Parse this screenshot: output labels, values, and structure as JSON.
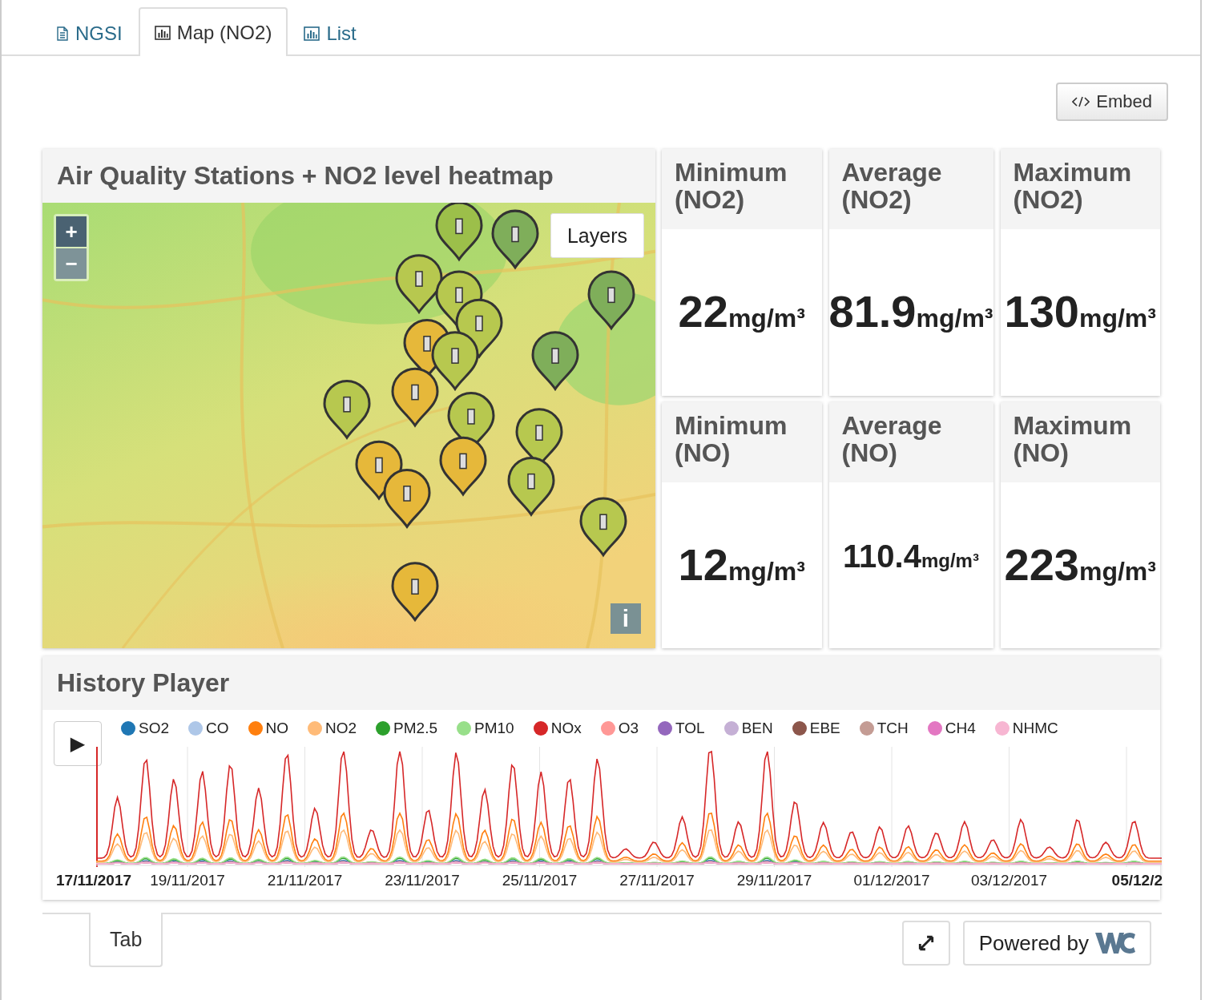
{
  "tabs": [
    {
      "label": "NGSI",
      "selected": false
    },
    {
      "label": "Map (NO2)",
      "selected": true
    },
    {
      "label": "List",
      "selected": false
    }
  ],
  "embed_button": {
    "label": "Embed"
  },
  "map_panel": {
    "title": "Air Quality Stations + NO2 level heatmap",
    "zoom_in": "+",
    "zoom_out": "−",
    "layers_button": "Layers",
    "info_button": "i"
  },
  "stats": [
    {
      "title": "Minimum (NO2)",
      "value": "22",
      "unit": "mg/m³"
    },
    {
      "title": "Average (NO2)",
      "value": "81.9",
      "unit": "mg/m³"
    },
    {
      "title": "Maximum (NO2)",
      "value": "130",
      "unit": "mg/m³"
    },
    {
      "title": "Minimum (NO)",
      "value": "12",
      "unit": "mg/m³"
    },
    {
      "title": "Average (NO)",
      "value": "110.4",
      "unit": "mg/m³"
    },
    {
      "title": "Maximum (NO)",
      "value": "223",
      "unit": "mg/m³"
    }
  ],
  "history_player": {
    "title": "History Player",
    "play_button": "▶",
    "legend": [
      {
        "label": "SO2",
        "color": "#1f77b4"
      },
      {
        "label": "CO",
        "color": "#aec7e8"
      },
      {
        "label": "NO",
        "color": "#ff7f0e"
      },
      {
        "label": "NO2",
        "color": "#ffbb78"
      },
      {
        "label": "PM2.5",
        "color": "#2ca02c"
      },
      {
        "label": "PM10",
        "color": "#98df8a"
      },
      {
        "label": "NOx",
        "color": "#d62728"
      },
      {
        "label": "O3",
        "color": "#ff9896"
      },
      {
        "label": "TOL",
        "color": "#9467bd"
      },
      {
        "label": "BEN",
        "color": "#c5b0d5"
      },
      {
        "label": "EBE",
        "color": "#8c564b"
      },
      {
        "label": "TCH",
        "color": "#c49c94"
      },
      {
        "label": "CH4",
        "color": "#e377c2"
      },
      {
        "label": "NHMC",
        "color": "#f7b6d2"
      }
    ],
    "x_labels": [
      "17/11/2017",
      "19/11/2017",
      "21/11/2017",
      "23/11/2017",
      "25/11/2017",
      "27/11/2017",
      "29/11/2017",
      "01/12/2017",
      "03/12/2017",
      "05/12/2"
    ]
  },
  "bottom_tabs": [
    {
      "label": "Tab",
      "selected": true
    }
  ],
  "powered_by": {
    "label": "Powered by"
  }
}
